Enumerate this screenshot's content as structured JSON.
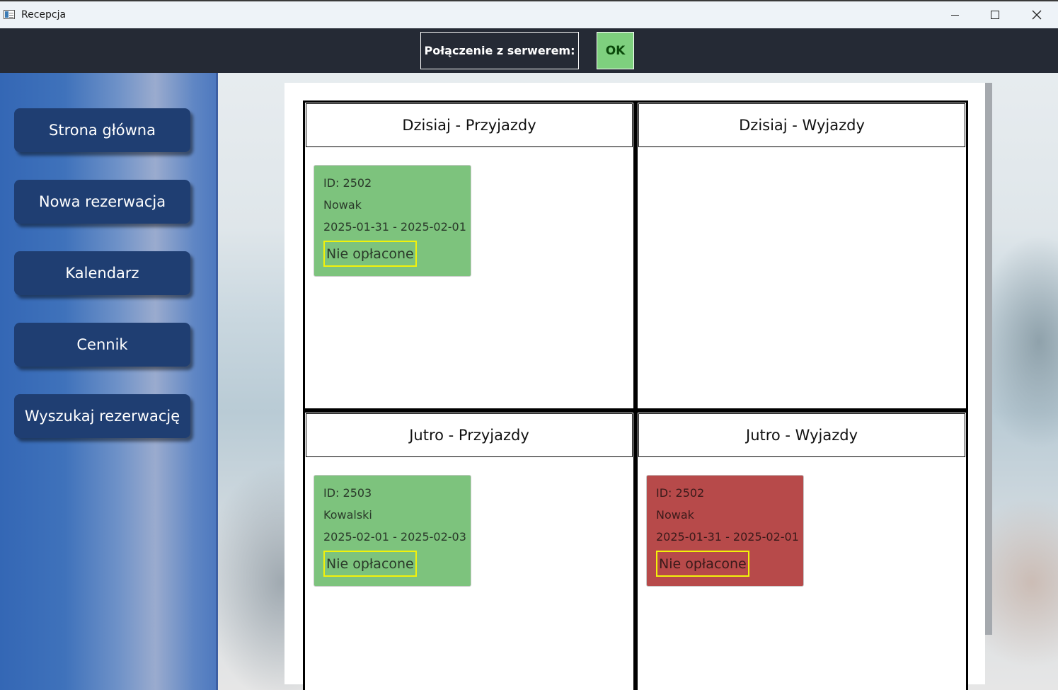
{
  "window": {
    "title": "Recepcja"
  },
  "topbar": {
    "connection_label": "Połączenie z serwerem:",
    "connection_status": "OK",
    "status_color": "#7ed07e"
  },
  "sidebar": {
    "items": [
      {
        "label": "Strona główna"
      },
      {
        "label": "Nowa rezerwacja"
      },
      {
        "label": "Kalendarz"
      },
      {
        "label": "Cennik"
      },
      {
        "label": "Wyszukaj rezerwację"
      }
    ]
  },
  "sections": {
    "today_arrivals": {
      "title": "Dzisiaj - Przyjazdy",
      "cards": [
        {
          "id": "ID: 2502",
          "name": "Nowak",
          "dates": "2025-01-31 - 2025-02-01",
          "payment": "Nie opłacone",
          "color": "#7dc37d"
        }
      ]
    },
    "today_departures": {
      "title": "Dzisiaj - Wyjazdy",
      "cards": []
    },
    "tomorrow_arrivals": {
      "title": "Jutro - Przyjazdy",
      "cards": [
        {
          "id": "ID: 2503",
          "name": "Kowalski",
          "dates": "2025-02-01 - 2025-02-03",
          "payment": "Nie opłacone",
          "color": "#7dc37d"
        }
      ]
    },
    "tomorrow_departures": {
      "title": "Jutro - Wyjazdy",
      "cards": [
        {
          "id": "ID: 2502",
          "name": "Nowak",
          "dates": "2025-01-31 - 2025-02-01",
          "payment": "Nie opłacone",
          "color": "#b74a4a"
        }
      ]
    }
  }
}
